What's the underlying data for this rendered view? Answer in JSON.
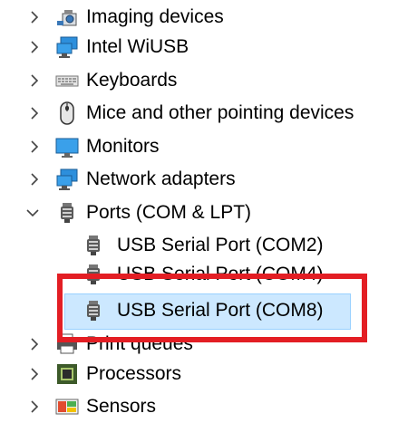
{
  "devices": [
    {
      "label": "Imaging devices",
      "expanded": false,
      "icon": "camera-icon"
    },
    {
      "label": "Intel WiUSB",
      "expanded": false,
      "icon": "monitor-network-icon"
    },
    {
      "label": "Keyboards",
      "expanded": false,
      "icon": "keyboard-icon"
    },
    {
      "label": "Mice and other pointing devices",
      "expanded": false,
      "icon": "mouse-icon"
    },
    {
      "label": "Monitors",
      "expanded": false,
      "icon": "monitor-icon"
    },
    {
      "label": "Network adapters",
      "expanded": false,
      "icon": "network-adapter-icon"
    },
    {
      "label": "Ports (COM & LPT)",
      "expanded": true,
      "icon": "port-icon",
      "children": [
        {
          "label": "USB Serial Port (COM2)",
          "icon": "port-icon"
        },
        {
          "label": "USB Serial Port (COM4)",
          "icon": "port-icon"
        },
        {
          "label": "USB Serial Port (COM8)",
          "icon": "port-icon",
          "selected": true
        }
      ]
    },
    {
      "label": "Print queues",
      "expanded": false,
      "icon": "printer-icon"
    },
    {
      "label": "Processors",
      "expanded": false,
      "icon": "processor-icon"
    },
    {
      "label": "Sensors",
      "expanded": false,
      "icon": "sensor-icon"
    }
  ],
  "colors": {
    "selection_bg": "#cce8ff",
    "selection_border": "#99d1ff",
    "highlight_box": "#e31e24"
  }
}
